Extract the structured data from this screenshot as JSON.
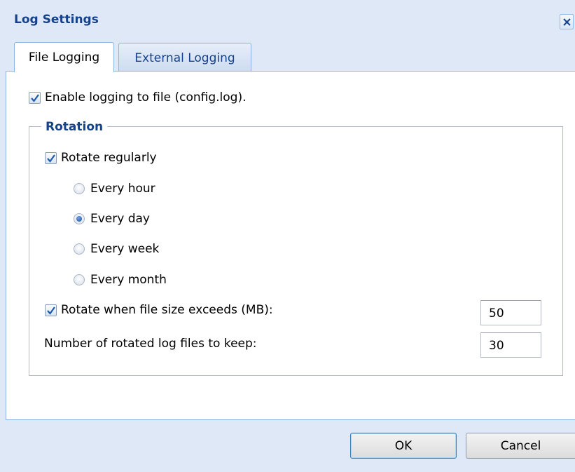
{
  "window": {
    "title": "Log Settings"
  },
  "tabs": [
    {
      "label": "File Logging",
      "active": true
    },
    {
      "label": "External Logging",
      "active": false
    }
  ],
  "file_logging": {
    "enable_label": "Enable logging to file (config.log).",
    "enable_checked": true,
    "rotation": {
      "legend": "Rotation",
      "rotate_regularly_label": "Rotate regularly",
      "rotate_regularly_checked": true,
      "intervals": [
        {
          "label": "Every hour",
          "selected": false
        },
        {
          "label": "Every day",
          "selected": true
        },
        {
          "label": "Every week",
          "selected": false
        },
        {
          "label": "Every month",
          "selected": false
        }
      ],
      "size_label": "Rotate when file size exceeds (MB):",
      "size_checked": true,
      "size_value": "50",
      "keep_label": "Number of rotated log files to keep:",
      "keep_value": "30"
    }
  },
  "buttons": {
    "ok": "OK",
    "cancel": "Cancel"
  },
  "colors": {
    "accent": "#15428b",
    "frame": "#dfe8f6",
    "border": "#8db2e3"
  }
}
